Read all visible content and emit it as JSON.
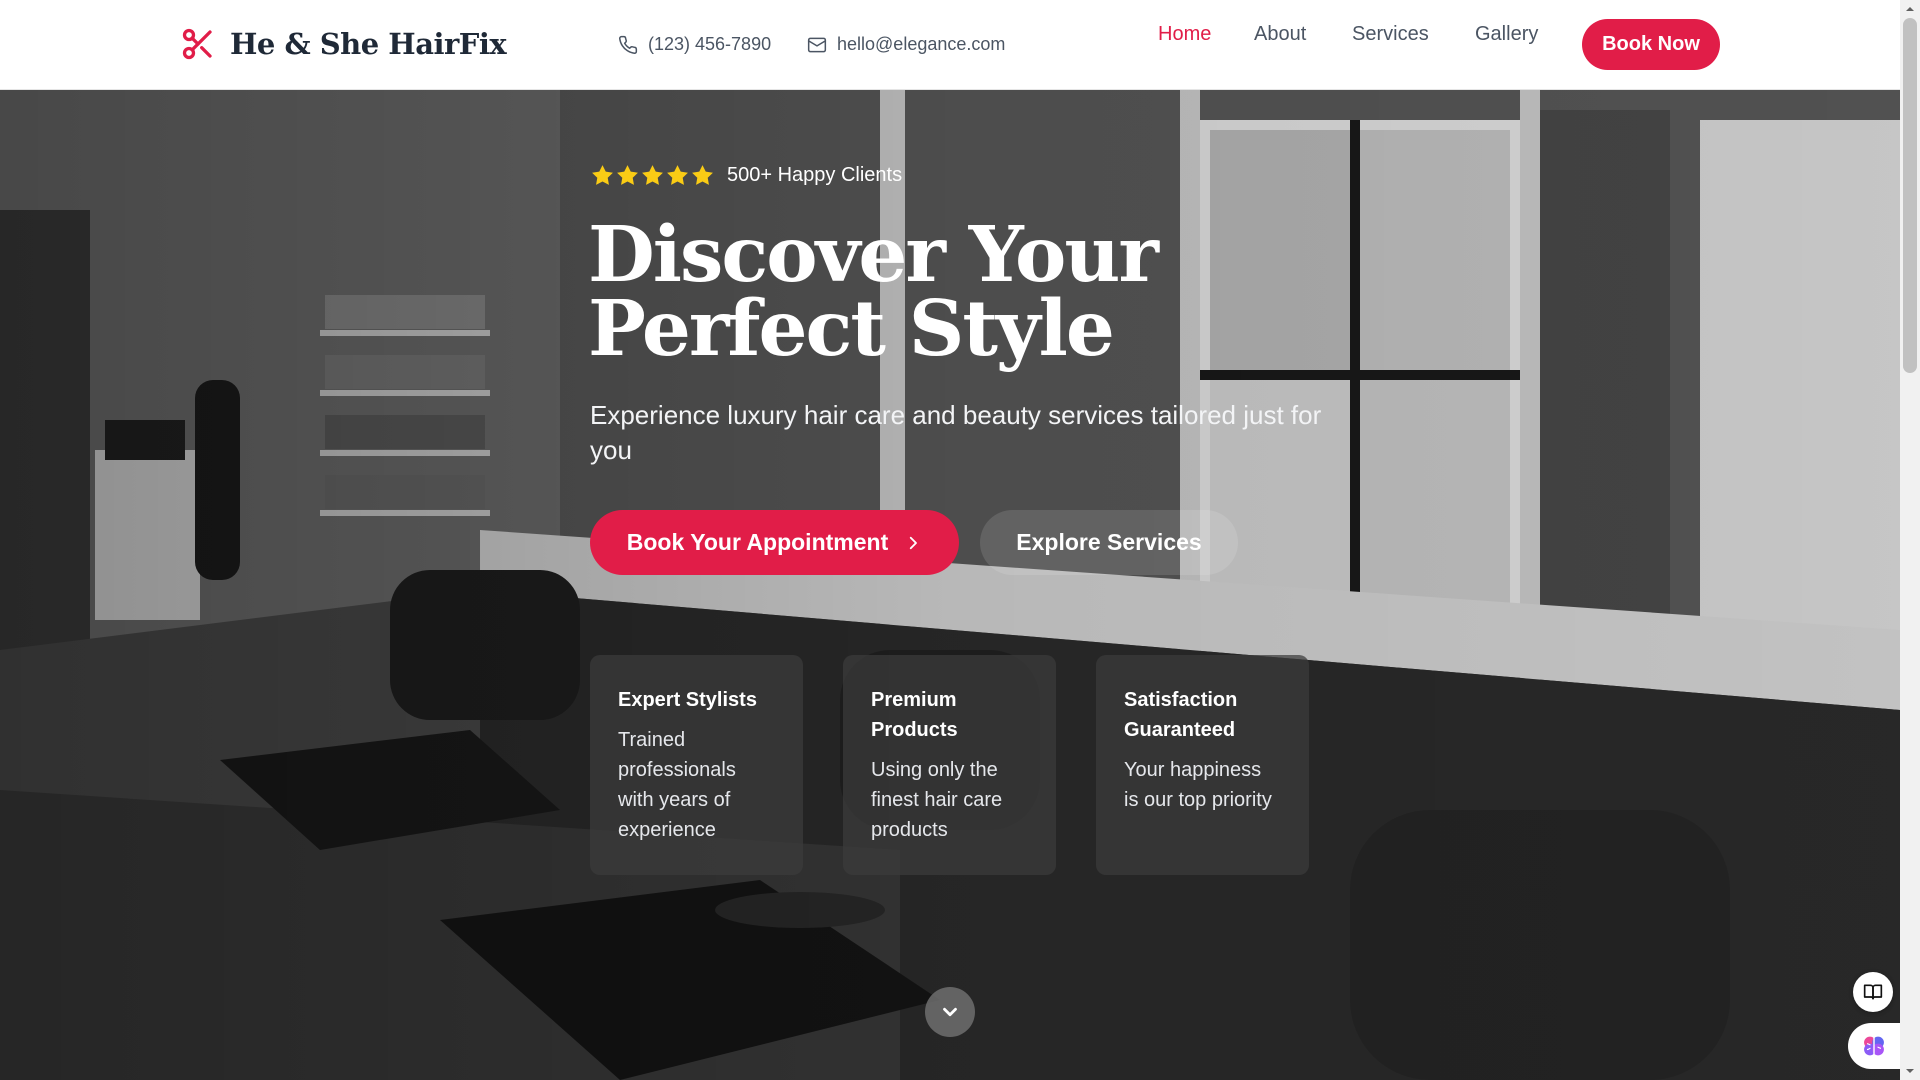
{
  "brand": {
    "name": "He & She HairFix",
    "accent_color": "#e11d48",
    "icon": "scissors-icon"
  },
  "header": {
    "phone": "(123) 456-7890",
    "email": "hello@elegance.com",
    "nav": [
      {
        "label": "Home",
        "active": true
      },
      {
        "label": "About",
        "active": false
      },
      {
        "label": "Services",
        "active": false
      },
      {
        "label": "Gallery",
        "active": false
      }
    ],
    "cta": "Book Now"
  },
  "hero": {
    "rating": {
      "stars": 5,
      "text": "500+ Happy Clients"
    },
    "headline_line1": "Discover Your",
    "headline_line2": "Perfect Style",
    "subtitle": "Experience luxury hair care and beauty services tailored just for you",
    "primary_button": "Book Your Appointment",
    "secondary_button": "Explore Services",
    "features": [
      {
        "title": "Expert Stylists",
        "description": "Trained professionals with years of experience"
      },
      {
        "title": "Premium Products",
        "description": "Using only the finest hair care products"
      },
      {
        "title": "Satisfaction Guaranteed",
        "description": "Your happiness is our top priority"
      }
    ]
  },
  "widgets": {
    "book_icon": "book-icon",
    "brain_icon": "brain-icon"
  }
}
